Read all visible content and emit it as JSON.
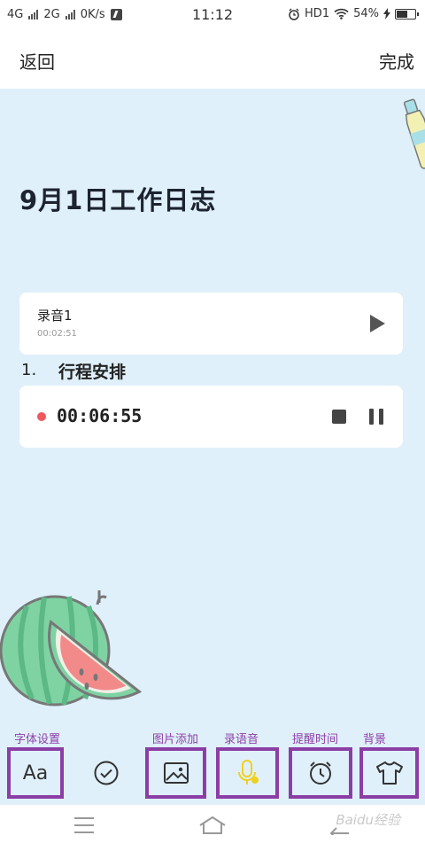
{
  "status_bar": {
    "net1": "4G",
    "net2": "2G",
    "speed": "0K/s",
    "time": "11:12",
    "hd": "HD1",
    "battery_text": "54%",
    "battery_level": 0.54
  },
  "header": {
    "back_label": "返回",
    "done_label": "完成"
  },
  "note": {
    "title": "9月1日工作日志",
    "recording": {
      "name": "录音1",
      "duration": "00:02:51"
    },
    "list_item": {
      "number": "1.",
      "text": "行程安排"
    },
    "active_recording": {
      "timer": "00:06:55"
    }
  },
  "toolbar": {
    "font_caption": "字体设置",
    "font_label": "Aa",
    "image_caption": "图片添加",
    "voice_caption": "录语音",
    "reminder_caption": "提醒时间",
    "background_caption": "背景",
    "accent_color": "#8b3ea5",
    "icons": [
      "font-icon",
      "check-circle-icon",
      "image-icon",
      "microphone-icon",
      "alarm-clock-icon",
      "tshirt-icon"
    ]
  },
  "system_nav": {
    "watermark": "Baidu经验"
  }
}
